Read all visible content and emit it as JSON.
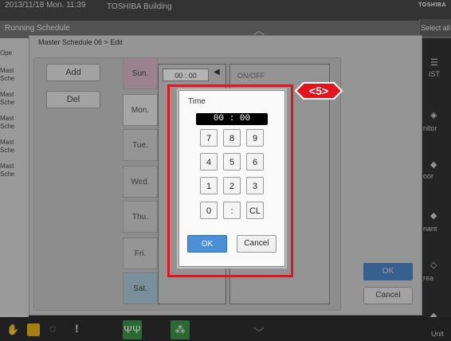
{
  "status": {
    "datetime": "2013/11/18 Mon. 11:39",
    "building": "TOSHIBA Building",
    "brand": "TOSHIBA",
    "running_schedule": "Running Schedule",
    "select_all": "Select all"
  },
  "left_list": {
    "header": "Ope",
    "rows": [
      "Mast",
      "Sche",
      "Mast",
      "Sche",
      "Mast",
      "Sche",
      "Mast",
      "Sche",
      "Mast",
      "Sche"
    ]
  },
  "right_sidebar": {
    "items": [
      "IST",
      "nitor",
      "oor",
      "nant",
      "rea",
      "Unit"
    ]
  },
  "edit_dialog": {
    "title": "Master Schedule 06 > Edit",
    "add_label": "Add",
    "del_label": "Del",
    "days": [
      "Sun.",
      "Mon.",
      "Tue.",
      "Wed.",
      "Thu.",
      "Fri.",
      "Sat."
    ],
    "first_time": "00 : 00",
    "first_action": "ON/OFF",
    "ok_label": "OK",
    "cancel_label": "Cancel"
  },
  "callout": {
    "label": "<5>"
  },
  "time_dialog": {
    "title": "Time",
    "value": "00 : 00",
    "keys": [
      "7",
      "8",
      "9",
      "4",
      "5",
      "6",
      "1",
      "2",
      "3",
      "0",
      ":",
      "CL"
    ],
    "ok_label": "OK",
    "cancel_label": "Cancel"
  },
  "colors": {
    "accent_ok": "#4a8fd8",
    "highlight": "#e4141f",
    "sunday": "#d8b4c4",
    "saturday": "#a5c8d8"
  }
}
